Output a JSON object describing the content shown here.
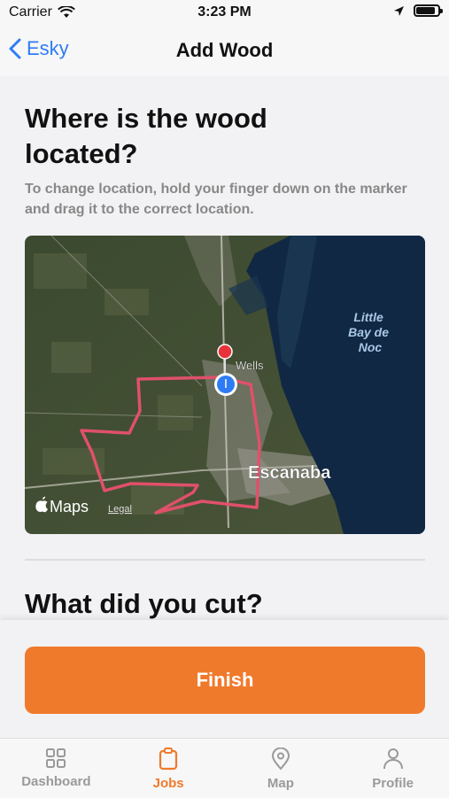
{
  "status_bar": {
    "carrier": "Carrier",
    "time": "3:23 PM",
    "battery_level": 0.9
  },
  "nav": {
    "back_label": "Esky",
    "title": "Add Wood"
  },
  "section_location": {
    "heading": "Where is the wood located?",
    "hint": "To change location, hold your finger down on the marker and drag it to the correct location."
  },
  "map": {
    "labels": {
      "water": [
        "Little",
        "Bay de",
        "Noc"
      ],
      "town_small": "Wells",
      "town_large": "Escanaba"
    },
    "attribution": {
      "brand": "Maps",
      "legal": "Legal"
    },
    "icons": [
      "location-pin-icon",
      "user-location-icon",
      "apple-logo-icon"
    ]
  },
  "section_cut": {
    "heading": "What did you cut?"
  },
  "actions": {
    "finish_label": "Finish"
  },
  "tabs": [
    {
      "label": "Dashboard",
      "icon": "grid-icon",
      "active": false
    },
    {
      "label": "Jobs",
      "icon": "clipboard-icon",
      "active": true
    },
    {
      "label": "Map",
      "icon": "map-pin-icon",
      "active": false
    },
    {
      "label": "Profile",
      "icon": "person-icon",
      "active": false
    }
  ],
  "colors": {
    "accent": "#f07a2c",
    "link": "#2f7cf6",
    "route": "#e0506a"
  }
}
